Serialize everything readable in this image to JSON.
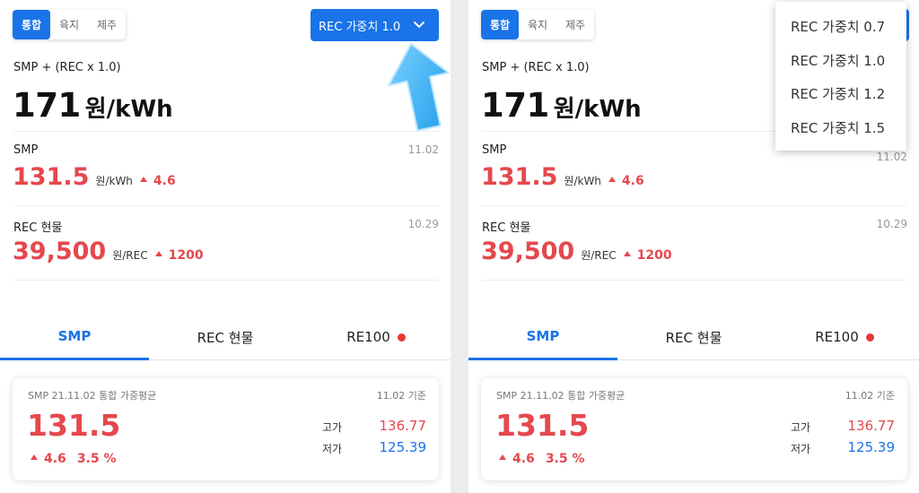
{
  "colors": {
    "accent": "#1a73e8",
    "up": "#e5484d",
    "low": "#1a73e8"
  },
  "screens": [
    {
      "region_tabs": [
        "통합",
        "육지",
        "제주"
      ],
      "weight_button": {
        "label": "REC 가중치 1.0",
        "icon": "chevron-down-icon"
      },
      "formula": "SMP + (REC x 1.0)",
      "total": {
        "value": "171",
        "unit": "원/kWh"
      },
      "smp": {
        "label": "SMP",
        "date": "11.02",
        "value": "131.5",
        "unit": "원/kWh",
        "change": "4.6"
      },
      "rec": {
        "label": "REC 현물",
        "date": "10.29",
        "value": "39,500",
        "unit": "원/REC",
        "change": "1200"
      },
      "tabs": [
        "SMP",
        "REC 현물",
        "RE100"
      ],
      "card": {
        "title": "SMP 21.11.02 통합 가중평균",
        "date": "11.02 기준",
        "value": "131.5",
        "change": "4.6",
        "percent": "3.5 %",
        "high_label": "고가",
        "high_value": "136.77",
        "low_label": "저가",
        "low_value": "125.39"
      }
    },
    {
      "region_tabs": [
        "통합",
        "육지",
        "제주"
      ],
      "formula": "SMP + (REC x 1.0)",
      "total": {
        "value": "171",
        "unit": "원/kWh"
      },
      "smp": {
        "label": "SMP",
        "date": "11.02",
        "value": "131.5",
        "unit": "원/kWh",
        "change": "4.6"
      },
      "rec": {
        "label": "REC 현물",
        "date": "10.29",
        "value": "39,500",
        "unit": "원/REC",
        "change": "1200"
      },
      "tabs": [
        "SMP",
        "REC 현물",
        "RE100"
      ],
      "card": {
        "title": "SMP 21.11.02 통합 가중평균",
        "date": "11.02 기준",
        "value": "131.5",
        "change": "4.6",
        "percent": "3.5 %",
        "high_label": "고가",
        "high_value": "136.77",
        "low_label": "저가",
        "low_value": "125.39"
      },
      "dropdown": [
        "REC 가중치 0.7",
        "REC 가중치 1.0",
        "REC 가중치 1.2",
        "REC 가중치 1.5"
      ]
    }
  ]
}
